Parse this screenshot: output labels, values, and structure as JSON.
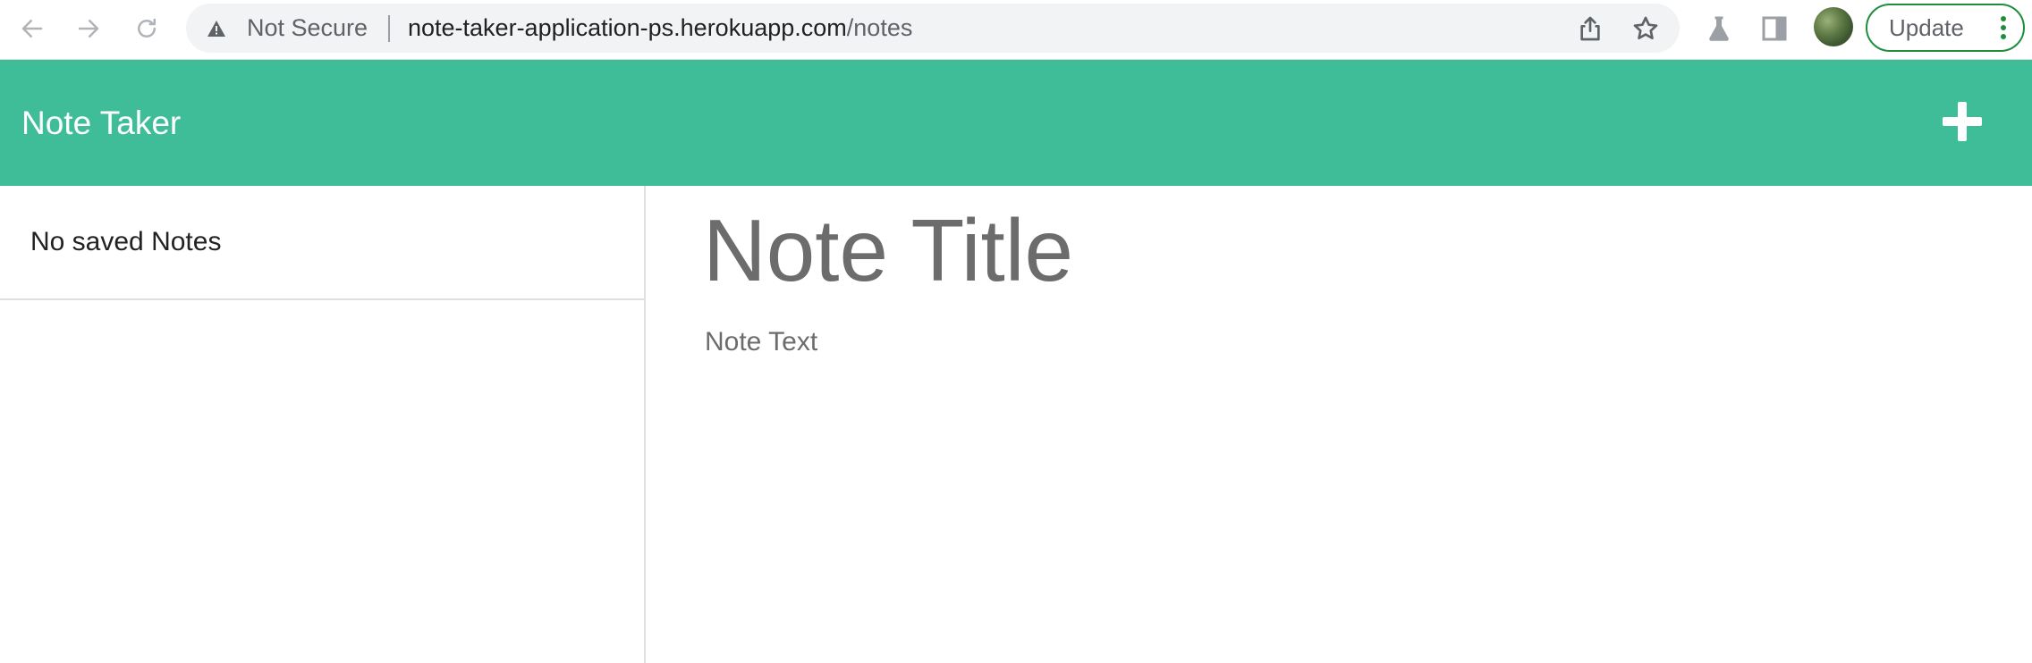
{
  "browser": {
    "back_icon": "arrow-left-icon",
    "forward_icon": "arrow-right-icon",
    "reload_icon": "reload-icon",
    "security_icon": "warning-triangle-icon",
    "security_label": "Not Secure",
    "url_host": "note-taker-application-ps.herokuapp.com",
    "url_path": "/notes",
    "share_icon": "share-icon",
    "bookmark_icon": "star-icon",
    "labs_icon": "flask-icon",
    "sidepanel_icon": "side-panel-icon",
    "update_label": "Update",
    "accent_color": "#1e8e3e"
  },
  "app": {
    "brand": "Note Taker",
    "header_color": "#3fbd99",
    "new_note_icon": "plus-icon"
  },
  "sidebar": {
    "empty_message": "No saved Notes"
  },
  "editor": {
    "title_placeholder": "Note Title",
    "text_placeholder": "Note Text"
  }
}
